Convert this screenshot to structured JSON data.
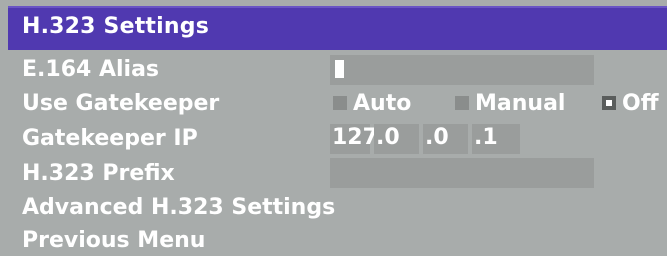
{
  "window": {
    "title": "H.323 Settings"
  },
  "fields": {
    "alias_label": "E.164 Alias",
    "alias_value": "",
    "gatekeeper_label": "Use Gatekeeper",
    "gatekeeper_options": [
      "Auto",
      "Manual",
      "Off"
    ],
    "gatekeeper_selected": "Off",
    "gatekeeper_ip_label": "Gatekeeper IP",
    "gatekeeper_ip": [
      "127",
      ".0",
      ".0",
      ".1"
    ],
    "prefix_label": "H.323 Prefix",
    "prefix_value": ""
  },
  "menu": {
    "advanced_label": "Advanced H.323 Settings",
    "previous_label": "Previous Menu"
  },
  "colors": {
    "title_bar": "#5039b0",
    "background": "#a8acab",
    "field": "#9a9d9c",
    "text": "#ffffff"
  }
}
